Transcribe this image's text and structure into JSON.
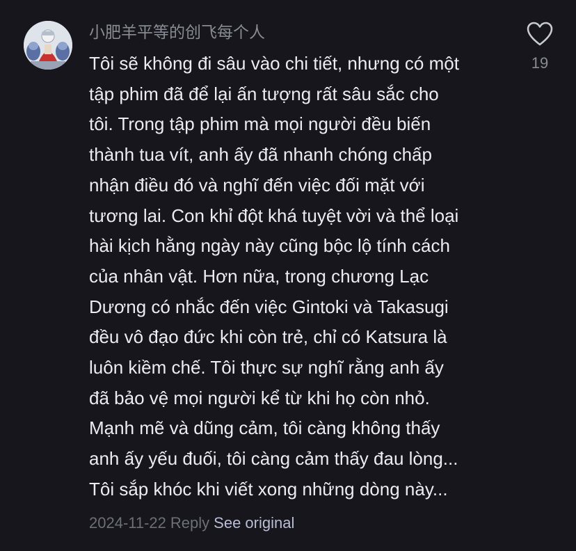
{
  "comment": {
    "username": "小肥羊平等的创飞每个人",
    "avatar_icon": "avatar-image",
    "lines": [
      "Tôi sẽ không đi sâu vào chi tiết, nhưng có một",
      "tập phim đã để lại ấn tượng rất sâu sắc cho",
      "tôi. Trong tập phim mà mọi người đều biến",
      "thành tua vít, anh ấy đã nhanh chóng chấp",
      "nhận điều đó và nghĩ đến việc đối mặt với",
      "tương lai. Con khỉ đột khá tuyệt vời và thể loại",
      "hài kịch hằng ngày này cũng bộc lộ tính cách",
      "của nhân vật. Hơn nữa, trong chương Lạc",
      "Dương có nhắc đến việc Gintoki và Takasugi",
      "đều vô đạo đức khi còn trẻ, chỉ có Katsura là",
      "luôn kiềm chế. Tôi thực sự nghĩ rằng anh ấy",
      "đã bảo vệ mọi người kể từ khi họ còn nhỏ.",
      "Mạnh mẽ và dũng cảm, tôi càng không thấy",
      "anh ấy yếu đuối, tôi càng cảm thấy đau lòng...",
      "Tôi sắp khóc khi viết xong những dòng này..."
    ],
    "like_icon": "heart-icon",
    "like_count": "19",
    "date": "2024-11-22",
    "reply_label": "Reply",
    "see_original_label": "See original"
  },
  "colors": {
    "background": "#16161c",
    "text": "#ececf0",
    "muted": "#8a8a93",
    "link": "#b9bed6"
  }
}
